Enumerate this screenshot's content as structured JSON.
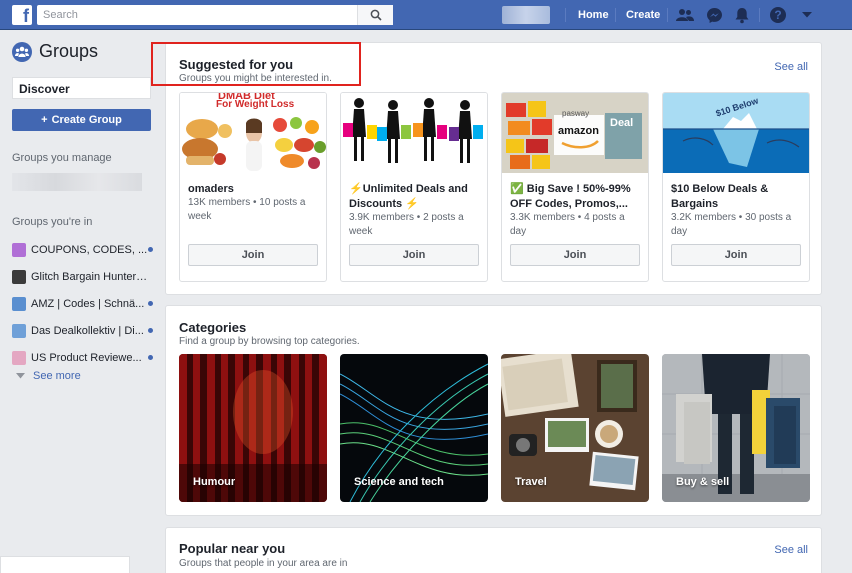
{
  "topbar": {
    "logo_letter": "f",
    "search_placeholder": "Search",
    "home_label": "Home",
    "create_label": "Create",
    "icons": [
      "friends-icon",
      "messenger-icon",
      "notifications-icon",
      "help-icon",
      "account-menu-icon"
    ]
  },
  "sidebar": {
    "title": "Groups",
    "discover_label": "Discover",
    "create_group_label": "Create Group",
    "manage_heading": "Groups you manage",
    "member_heading": "Groups you're in",
    "groups": [
      {
        "name": "COUPONS, CODES, ...",
        "unread": true,
        "color": "#b06fd6"
      },
      {
        "name": "Glitch Bargain Hunters...",
        "unread": false,
        "color": "#3b3b3b"
      },
      {
        "name": "AMZ | Codes | Schnä...",
        "unread": true,
        "color": "#5a8fd0"
      },
      {
        "name": "Das Dealkollektiv | Di...",
        "unread": true,
        "color": "#6fa0d8"
      },
      {
        "name": "US Product Reviewe...",
        "unread": true,
        "color": "#e4a7c2"
      }
    ],
    "see_more_label": "See more"
  },
  "suggested": {
    "title": "Suggested for you",
    "subtitle": "Groups you might be interested in.",
    "see_all_label": "See all",
    "join_label": "Join",
    "groups": [
      {
        "name": "omaders",
        "meta": "13K members • 10 posts a week",
        "image_text_top": "DMAB Diet",
        "image_text": "For Weight Loss"
      },
      {
        "name": "⚡Unlimited Deals and Discounts ⚡",
        "meta": "3.9K members • 2 posts a week"
      },
      {
        "name": "✅ Big Save ! 50%-99% OFF Codes, Promos,...",
        "meta": "3.3K members • 4 posts a day",
        "image_text_a": "amazon",
        "image_text_b": "Deal",
        "image_text_c": "pasway"
      },
      {
        "name": "$10 Below Deals & Bargains",
        "meta": "3.2K members • 30 posts a day",
        "image_text": "$10 Below"
      }
    ]
  },
  "categories": {
    "title": "Categories",
    "subtitle": "Find a group by browsing top categories.",
    "items": [
      {
        "label": "Humour"
      },
      {
        "label": "Science and tech"
      },
      {
        "label": "Travel"
      },
      {
        "label": "Buy & sell"
      }
    ]
  },
  "popular": {
    "title": "Popular near you",
    "subtitle": "Groups that people in your area are in",
    "see_all_label": "See all"
  },
  "colors": {
    "brand_blue": "#4267b2",
    "highlight_red": "#e0231e"
  }
}
